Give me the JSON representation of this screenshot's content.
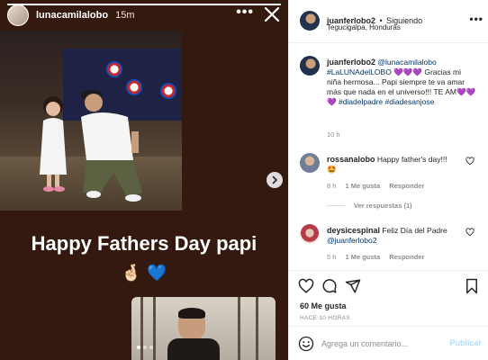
{
  "story": {
    "username": "lunacamilalobo",
    "time": "15m",
    "more": "•••",
    "caption": "Happy Fathers Day papi",
    "emojis": [
      "🤞🏻",
      "💙"
    ],
    "progress_fraction": 1.0,
    "carousel_dots": 3,
    "carousel_active": 0
  },
  "post": {
    "author": {
      "username": "juanferlobo2",
      "separator": "•",
      "follow_status": "Siguiendo",
      "location": "Tegucigalpa, Honduras"
    },
    "caption": {
      "username": "juanferlobo2",
      "mention": "@lunacamilalobo",
      "hashtag1": "#LaLUNAdelLOBO",
      "hearts1": "💜💜💜",
      "text1": "Gracias mi niña hermosa... Papi siempre te va amar más que nada en el universo!!! TE AM",
      "hearts2": "💜💜💜",
      "hashtag2": "#diadelpadre",
      "hashtag3": "#diadesanjose",
      "age": "10 h"
    },
    "comments": [
      {
        "username": "rossanalobo",
        "text": "Happy father's day!!!",
        "emoji": "🤩",
        "age": "8 h",
        "likes": "1 Me gusta",
        "reply": "Responder",
        "replies_toggle": "Ver respuestas (1)"
      },
      {
        "username": "deysicespinal",
        "text": "Feliz Día del Padre",
        "mention": "@juanferlobo2",
        "age": "5 h",
        "likes": "1 Me gusta",
        "reply": "Responder"
      }
    ],
    "likes": "60 Me gusta",
    "posted_ago": "HACE 10 HORAS",
    "comment_placeholder": "Agrega un comentario...",
    "publish_label": "Publicar"
  },
  "colors": {
    "story_bg": "#34190f",
    "link": "#00376b",
    "muted": "#8e8e8e",
    "publish_disabled": "#b2dffc"
  },
  "icons": [
    "close-icon",
    "more-icon",
    "next-arrow-icon",
    "heart-icon",
    "comment-icon",
    "share-icon",
    "bookmark-icon",
    "emoji-icon"
  ]
}
